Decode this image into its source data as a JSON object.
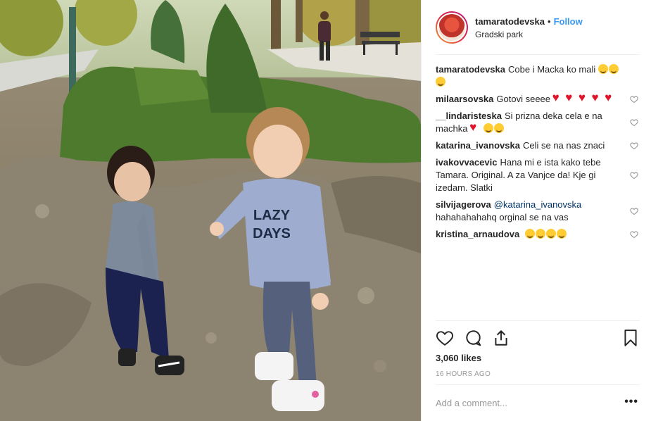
{
  "header": {
    "username": "tamaratodevska",
    "separator": "•",
    "follow_label": "Follow",
    "location": "Gradski park"
  },
  "comments": [
    {
      "user": "tamaratodevska",
      "text": "Cobe i Macka ko mali",
      "emojis": [
        "face-eyes-rolling",
        "grinning-face",
        "star-struck"
      ],
      "likeable": false
    },
    {
      "user": "milaarsovska",
      "text": "Gotovi seeee",
      "emojis": [
        "red-heart",
        "red-heart",
        "red-heart",
        "red-heart",
        "red-heart"
      ],
      "likeable": true
    },
    {
      "user": "__lindaristeska",
      "text": "Si prizna deka cela e na machka",
      "emojis": [
        "red-heart",
        "laughing-face",
        "smiling-face"
      ],
      "likeable": true
    },
    {
      "user": "katarina_ivanovska",
      "text": "Celi se na nas znaci",
      "emojis": [],
      "likeable": true
    },
    {
      "user": "ivakovvacevic",
      "text": "Hana mi e ista kako tebe Tamara. Original. A za Vanjce da! Kje gi izedam. Slatki",
      "emojis": [],
      "likeable": true
    },
    {
      "user": "silvijagerova",
      "mention": "@katarina_ivanovska",
      "text": "hahahahahahq orginal se na vas",
      "emojis": [],
      "likeable": true
    },
    {
      "user": "kristina_arnaudova",
      "text": "",
      "emojis": [
        "tears-of-joy",
        "tears-of-joy",
        "tears-of-joy",
        "tears-of-joy"
      ],
      "likeable": true
    }
  ],
  "actions": {
    "icons": [
      "heart-icon",
      "comment-icon",
      "share-icon",
      "bookmark-icon"
    ]
  },
  "likes": "3,060 likes",
  "timestamp": "16 HOURS AGO",
  "add_comment": {
    "placeholder": "Add a comment..."
  },
  "more_label": "•••",
  "photo": {
    "shirt_text_line1": "LAZY",
    "shirt_text_line2": "DAYS"
  },
  "colors": {
    "follow": "#3897f0",
    "heart": "#e0152b",
    "muted": "#999999",
    "border": "#efefef"
  }
}
